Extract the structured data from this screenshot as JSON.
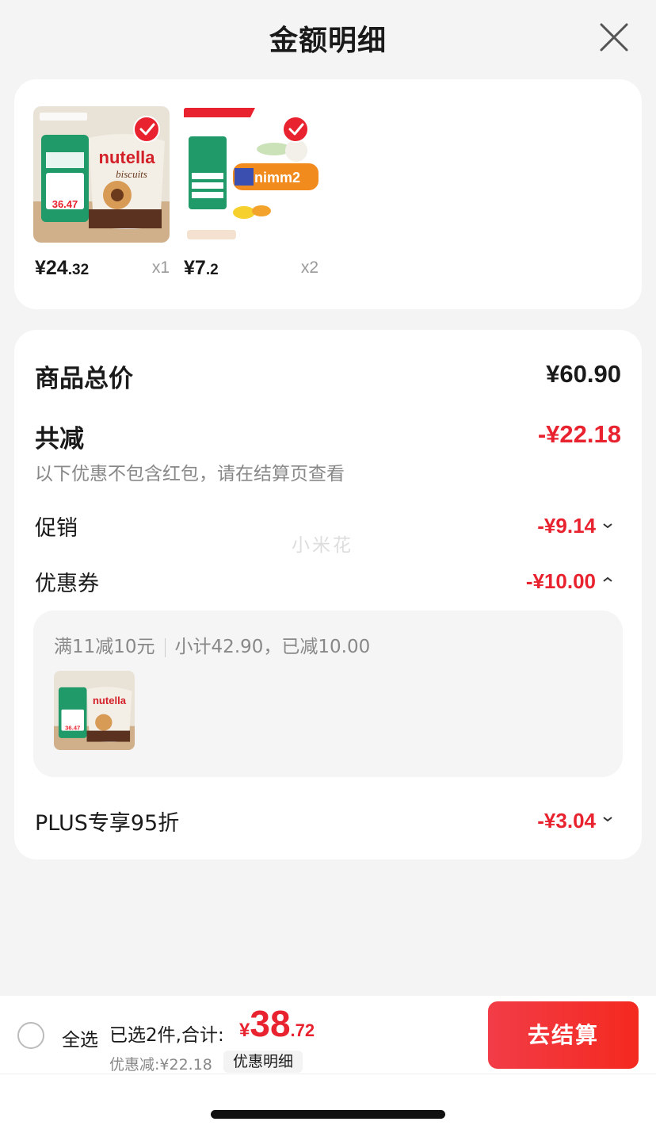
{
  "header": {
    "title": "金额明细"
  },
  "products": [
    {
      "price_int": "¥24",
      "price_dec": ".32",
      "qty": "x1",
      "image": "nutella-biscuits-product-image"
    },
    {
      "price_int": "¥7",
      "price_dec": ".2",
      "qty": "x2",
      "image": "nimm2-candy-product-image"
    }
  ],
  "summary": {
    "total_label": "商品总价",
    "total_value": "¥60.90",
    "reduce_label": "共减",
    "reduce_value": "-¥22.18",
    "note": "以下优惠不包含红包，请在结算页查看",
    "promo_label": "促销",
    "promo_value": "-¥9.14",
    "coupon_label": "优惠券",
    "coupon_value": "-¥10.00",
    "coupon_detail_rule": "满11减10元",
    "coupon_detail_sub": "小计42.90，已减10.00",
    "plus_label": "PLUS专享95折",
    "plus_value": "-¥3.04"
  },
  "watermark": "小米花",
  "bottom": {
    "select_all": "全选",
    "selected_text": "已选2件,合计:",
    "total_yen": "¥",
    "total_int": "38",
    "total_dec": ".72",
    "discount_text": "优惠减:¥22.18",
    "detail_button": "优惠明细",
    "checkout_button": "去结算"
  },
  "colors": {
    "accent_red": "#e8232f",
    "bg": "#f4f4f4",
    "card": "#ffffff"
  }
}
